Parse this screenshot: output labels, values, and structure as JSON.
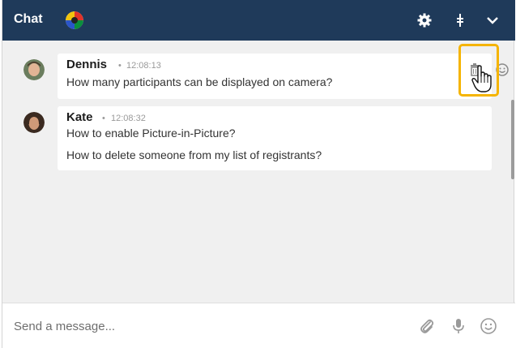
{
  "header": {
    "title": "Chat",
    "icons": [
      "avatar-flag",
      "gear-icon",
      "pin-icon",
      "chevron-down-icon"
    ],
    "color": "#1f3a5a"
  },
  "messages": [
    {
      "author": "Dennis",
      "dot": "•",
      "time": "12:08:13",
      "lines": [
        "How many participants can be displayed on camera?"
      ]
    },
    {
      "author": "Kate",
      "dot": "•",
      "time": "12:08:32",
      "lines": [
        "How to enable Picture-in-Picture?",
        "How to delete someone from my list of registrants?"
      ]
    }
  ],
  "message_actions": {
    "icons": [
      "delete-icon",
      "emoji-icon",
      "question-icon"
    ],
    "highlight_color": "#f5b400"
  },
  "composer": {
    "placeholder": "Send a message...",
    "icons": [
      "paperclip-icon",
      "microphone-icon",
      "emoji-icon"
    ]
  }
}
